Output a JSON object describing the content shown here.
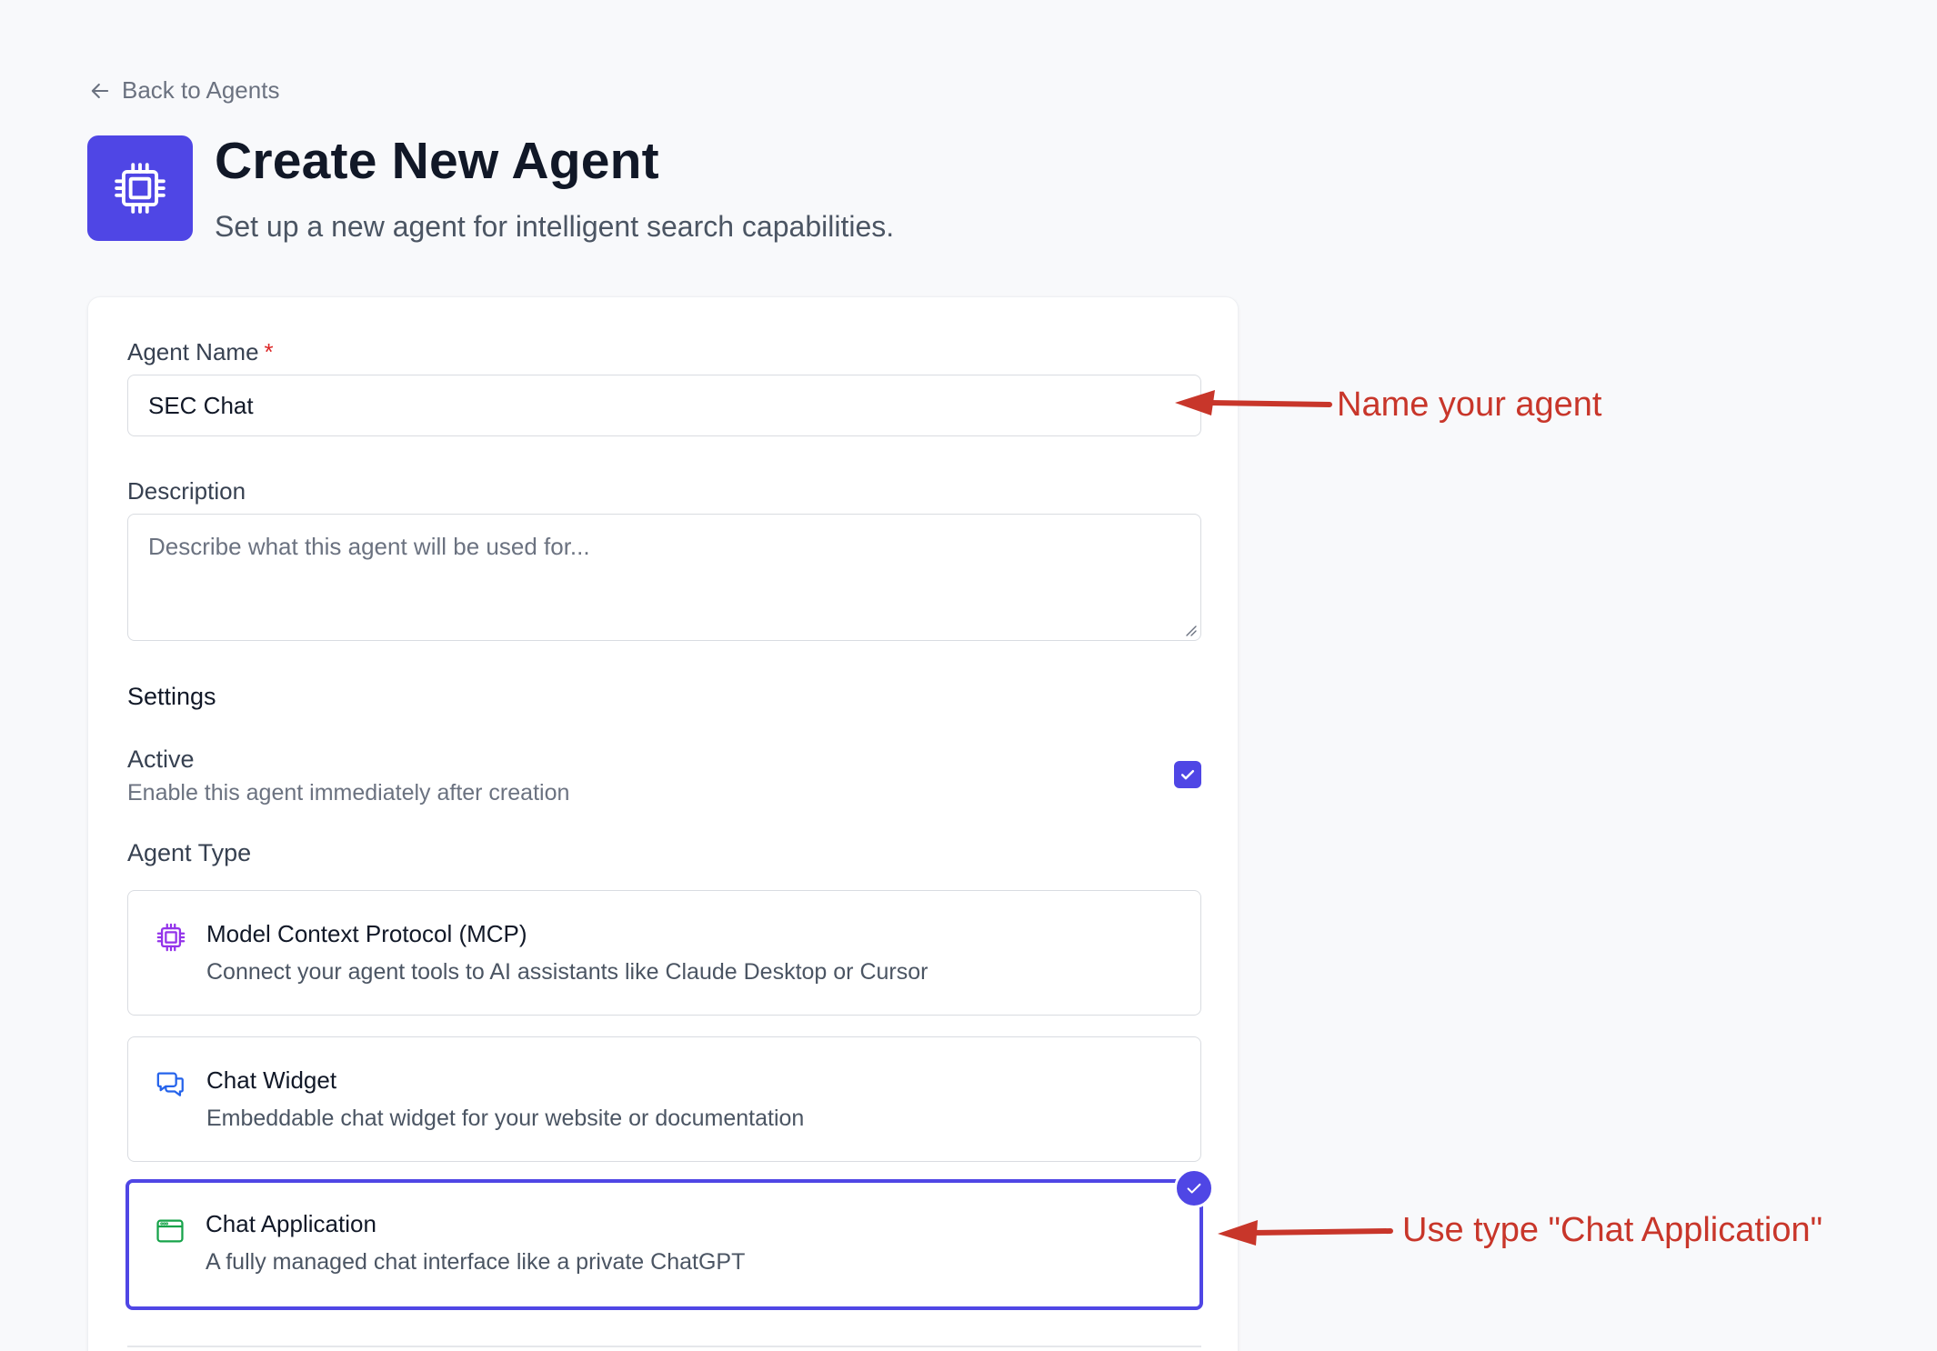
{
  "nav": {
    "back_label": "Back to Agents"
  },
  "header": {
    "title": "Create New Agent",
    "subtitle": "Set up a new agent for intelligent search capabilities."
  },
  "form": {
    "agent_name_label": "Agent Name",
    "required_mark": "*",
    "agent_name_value": "SEC Chat",
    "description_label": "Description",
    "description_placeholder": "Describe what this agent will be used for...",
    "settings_title": "Settings",
    "active_label": "Active",
    "active_description": "Enable this agent immediately after creation",
    "active_checked": true,
    "agent_type_label": "Agent Type",
    "agent_types": [
      {
        "title": "Model Context Protocol (MCP)",
        "description": "Connect your agent tools to AI assistants like Claude Desktop or Cursor",
        "icon": "cpu-chip-icon",
        "selected": false
      },
      {
        "title": "Chat Widget",
        "description": "Embeddable chat widget for your website or documentation",
        "icon": "chat-bubbles-icon",
        "selected": false
      },
      {
        "title": "Chat Application",
        "description": "A fully managed chat interface like a private ChatGPT",
        "icon": "browser-window-icon",
        "selected": true
      }
    ]
  },
  "annotations": {
    "name_hint": "Name your agent",
    "type_hint": "Use type \"Chat Application\""
  },
  "colors": {
    "accent": "#4f46e5",
    "annotation": "#c8362a",
    "background": "#f8f9fb",
    "mcp_icon": "#9333ea",
    "widget_icon": "#2563eb",
    "app_icon": "#16a34a"
  }
}
